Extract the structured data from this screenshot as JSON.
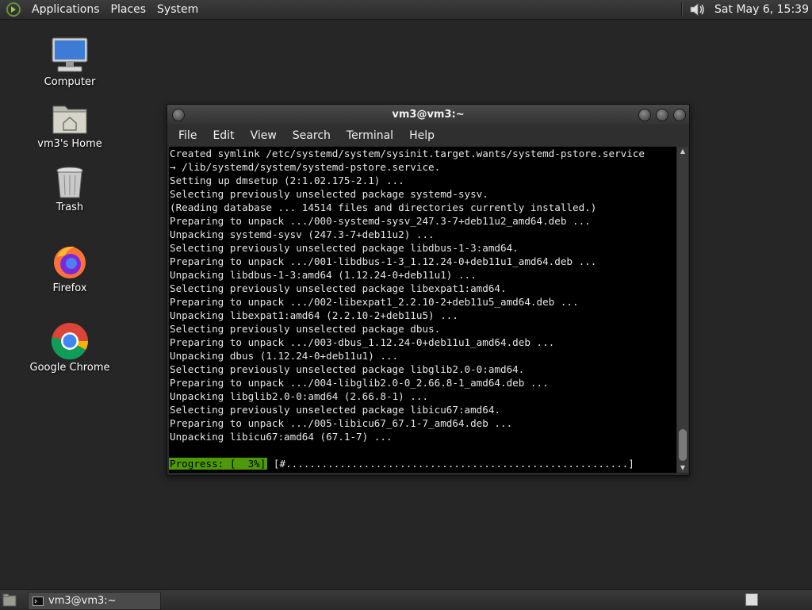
{
  "top_panel": {
    "menus": [
      "Applications",
      "Places",
      "System"
    ],
    "clock": "Sat May  6, 15:39"
  },
  "desktop_icons": [
    {
      "label": "Computer"
    },
    {
      "label": "vm3's Home"
    },
    {
      "label": "Trash"
    },
    {
      "label": "Firefox"
    },
    {
      "label": "Google Chrome"
    }
  ],
  "terminal": {
    "title": "vm3@vm3:~",
    "menus": [
      "File",
      "Edit",
      "View",
      "Search",
      "Terminal",
      "Help"
    ],
    "lines": [
      "Created symlink /etc/systemd/system/sysinit.target.wants/systemd-pstore.service",
      "→ /lib/systemd/system/systemd-pstore.service.",
      "Setting up dmsetup (2:1.02.175-2.1) ...",
      "Selecting previously unselected package systemd-sysv.",
      "(Reading database ... 14514 files and directories currently installed.)",
      "Preparing to unpack .../000-systemd-sysv_247.3-7+deb11u2_amd64.deb ...",
      "Unpacking systemd-sysv (247.3-7+deb11u2) ...",
      "Selecting previously unselected package libdbus-1-3:amd64.",
      "Preparing to unpack .../001-libdbus-1-3_1.12.24-0+deb11u1_amd64.deb ...",
      "Unpacking libdbus-1-3:amd64 (1.12.24-0+deb11u1) ...",
      "Selecting previously unselected package libexpat1:amd64.",
      "Preparing to unpack .../002-libexpat1_2.2.10-2+deb11u5_amd64.deb ...",
      "Unpacking libexpat1:amd64 (2.2.10-2+deb11u5) ...",
      "Selecting previously unselected package dbus.",
      "Preparing to unpack .../003-dbus_1.12.24-0+deb11u1_amd64.deb ...",
      "Unpacking dbus (1.12.24-0+deb11u1) ...",
      "Selecting previously unselected package libglib2.0-0:amd64.",
      "Preparing to unpack .../004-libglib2.0-0_2.66.8-1_amd64.deb ...",
      "Unpacking libglib2.0-0:amd64 (2.66.8-1) ...",
      "Selecting previously unselected package libicu67:amd64.",
      "Preparing to unpack .../005-libicu67_67.1-7_amd64.deb ...",
      "Unpacking libicu67:amd64 (67.1-7) ..."
    ],
    "progress_label": "Progress: [  3%]",
    "progress_bar": " [#.........................................................]"
  },
  "taskbar": {
    "window_button": "vm3@vm3:~"
  }
}
